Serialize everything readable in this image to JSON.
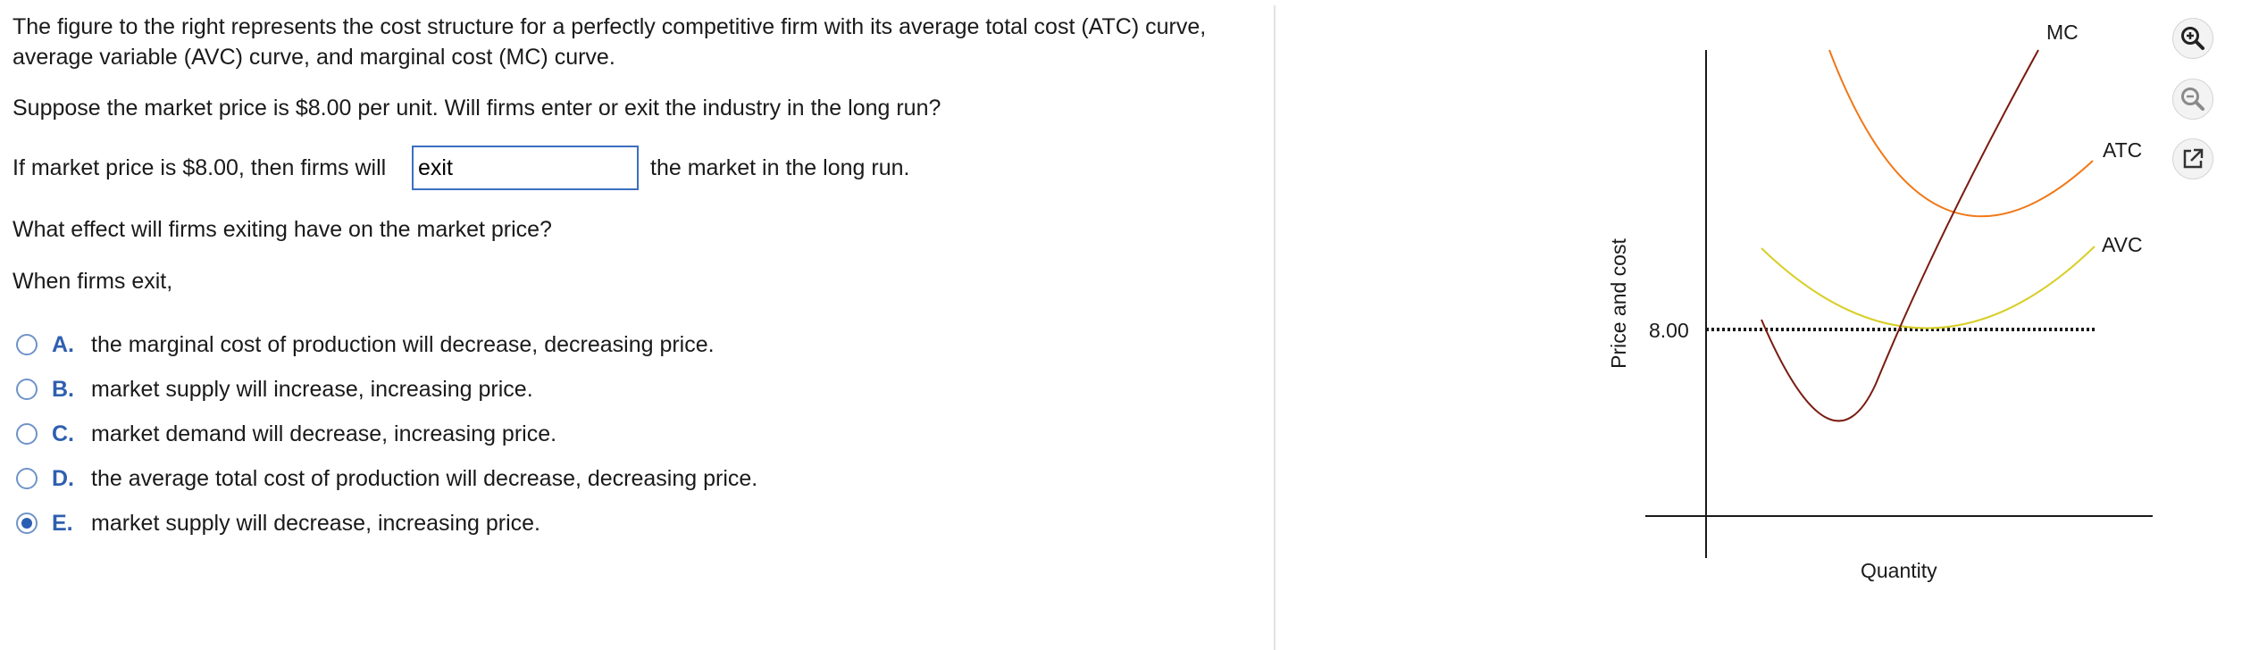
{
  "question": {
    "intro_line1": "The figure to the right represents the cost structure for a perfectly competitive firm with its average total cost (ATC) curve,",
    "intro_line2": "average variable (AVC) curve, and marginal cost (MC) curve.",
    "prompt1": "Suppose the market price is $8.00 per unit. Will firms enter or exit the industry in the long run?",
    "fill_before": "If market price is $8.00, then firms will",
    "fill_value": "exit",
    "fill_after": "the market in the long run.",
    "prompt2": "What effect will firms exiting have on the market price?",
    "prompt2_lead": "When firms exit,"
  },
  "choices": [
    {
      "letter": "A.",
      "text": "the marginal cost of production will decrease, decreasing price.",
      "selected": false
    },
    {
      "letter": "B.",
      "text": "market supply will increase, increasing price.",
      "selected": false
    },
    {
      "letter": "C.",
      "text": "market demand will decrease, increasing price.",
      "selected": false
    },
    {
      "letter": "D.",
      "text": "the average total cost of production will decrease, decreasing price.",
      "selected": false
    },
    {
      "letter": "E.",
      "text": "market supply will decrease, increasing price.",
      "selected": true
    }
  ],
  "graph": {
    "ylabel": "Price and cost",
    "xlabel": "Quantity",
    "price_label": "8.00",
    "mc_label": "MC",
    "atc_label": "ATC",
    "avc_label": "AVC",
    "colors": {
      "mc": "#7a1a10",
      "atc": "#f07818",
      "avc": "#d8cf2a",
      "price_line": "#1a1a1a"
    }
  },
  "tools": [
    {
      "name": "zoom-in-icon"
    },
    {
      "name": "zoom-out-icon"
    },
    {
      "name": "popout-icon"
    }
  ]
}
